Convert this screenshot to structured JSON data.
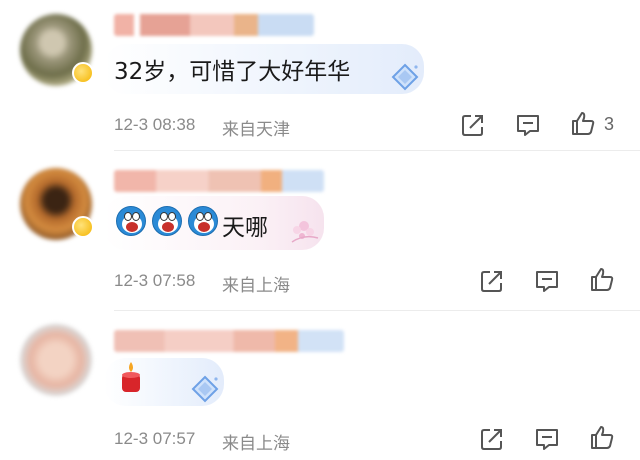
{
  "comments": [
    {
      "text": "32岁，可惜了大好年华",
      "time": "12-3 08:38",
      "location": "来自天津",
      "like_count": "3"
    },
    {
      "text": "天哪",
      "time": "12-3 07:58",
      "location": "来自上海"
    },
    {
      "text": "",
      "time": "12-3 07:57",
      "location": "来自上海"
    }
  ],
  "icons": {
    "share": "share-icon",
    "comment": "comment-icon",
    "like": "thumbs-up-icon",
    "diamond": "diamond-icon"
  },
  "colors": {
    "meta_text": "#8a8a8a",
    "icon_stroke": "#555555",
    "bubble_tint": "#e3ecfb"
  }
}
